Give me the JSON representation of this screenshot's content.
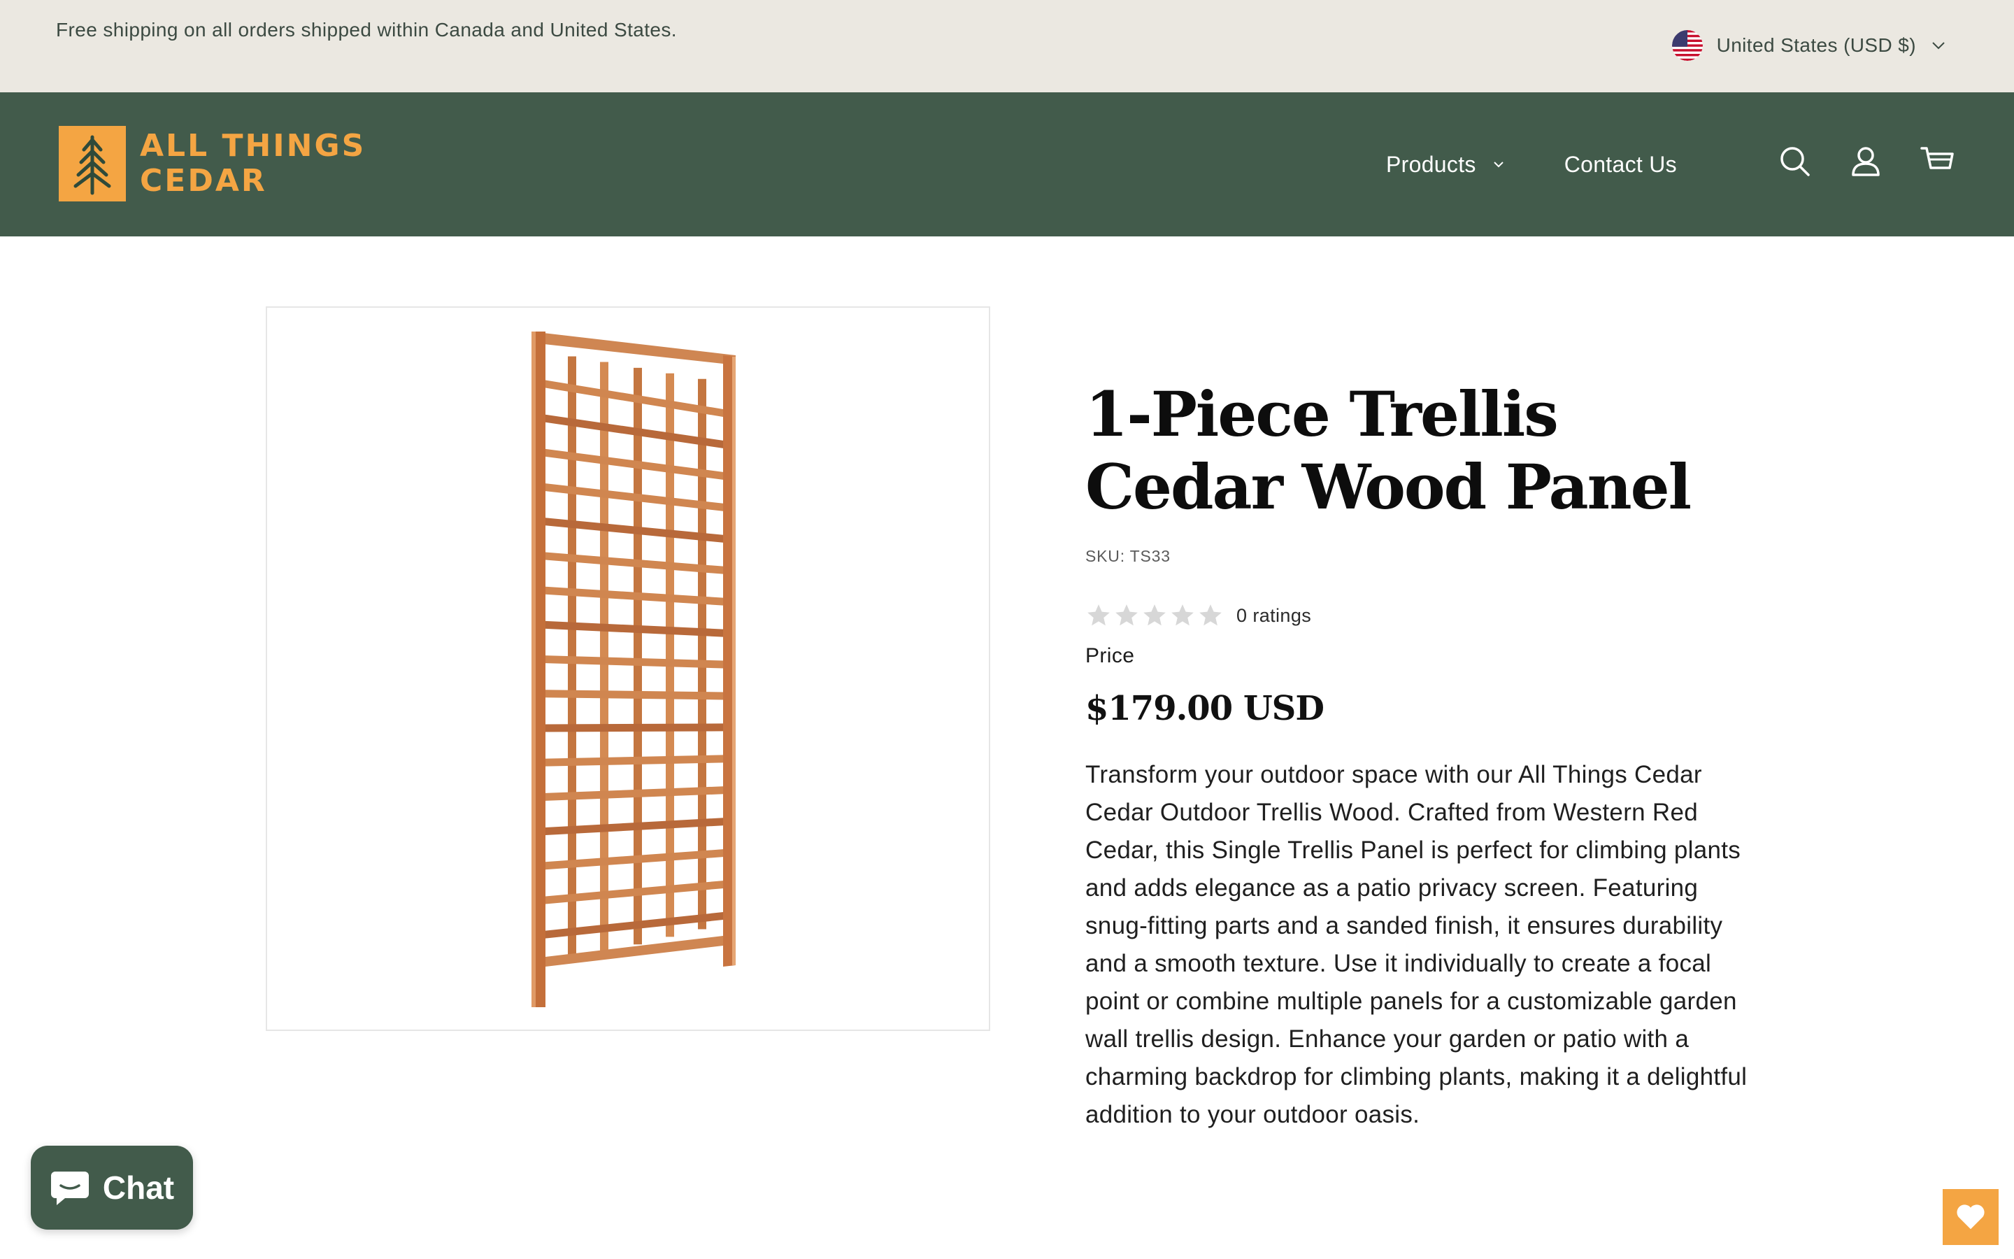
{
  "announcement": {
    "text": "Free shipping on all orders shipped within Canada and United States."
  },
  "currency_selector": {
    "label": "United States (USD $)",
    "flag_icon": "us-flag-icon",
    "chevron_icon": "chevron-down-icon"
  },
  "header": {
    "logo": {
      "line1": "ALL THINGS",
      "line2": "CEDAR",
      "icon": "pine-tree-icon"
    },
    "nav": [
      {
        "label": "Products",
        "has_dropdown": true
      },
      {
        "label": "Contact Us",
        "has_dropdown": false
      }
    ],
    "icons": [
      "search-icon",
      "account-icon",
      "cart-icon"
    ]
  },
  "product": {
    "title": "1-Piece Trellis Cedar Wood Panel",
    "sku_label": "SKU:",
    "sku_value": "TS33",
    "rating": {
      "stars_filled": 0,
      "stars_total": 5,
      "count_text": "0 ratings"
    },
    "price_label": "Price",
    "price": "$179.00 USD",
    "description": "Transform your outdoor space with our All Things Cedar Cedar Outdoor Trellis Wood. Crafted from Western Red Cedar, this Single Trellis Panel is perfect for climbing plants and adds elegance as a patio privacy screen. Featuring snug-fitting parts and a sanded finish, it ensures durability and a smooth texture. Use it individually to create a focal point or combine multiple panels for a customizable garden wall trellis design. Enhance your garden or patio with a charming backdrop for climbing plants, making it a delightful addition to your outdoor oasis."
  },
  "chat_widget": {
    "label": "Chat",
    "icon": "chat-bubble-icon"
  },
  "wishlist_widget": {
    "icon": "heart-icon"
  },
  "colors": {
    "announcement_bg": "#ebe8e1",
    "header_bg": "#425b4b",
    "brand_orange": "#f4a543",
    "wood": "#c97a45"
  }
}
